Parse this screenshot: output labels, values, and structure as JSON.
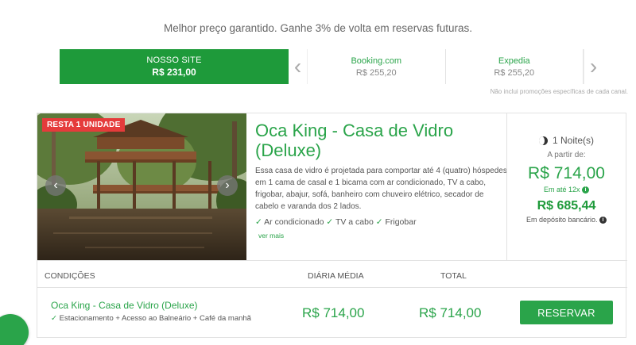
{
  "tagline": "Melhor preço garantido. Ganhe 3% de volta em reservas futuras.",
  "comparison": {
    "ours": {
      "label": "NOSSO SITE",
      "price": "R$ 231,00"
    },
    "others": [
      {
        "label": "Booking.com",
        "price": "R$ 255,20"
      },
      {
        "label": "Expedia",
        "price": "R$ 255,20"
      }
    ],
    "note": "Não inclui promoções específicas de cada canal.",
    "prev_icon": "chevron-left-icon",
    "next_icon": "chevron-right-icon"
  },
  "room": {
    "badge": "RESTA 1 UNIDADE",
    "title": "Oca King - Casa de Vidro (Deluxe)",
    "description": "Essa casa de vidro é projetada para comportar até 4 (quatro) hóspedes em 1 cama de casal e 1 bicama com ar condicionado, TV a cabo, frigobar, abajur, sofá, banheiro com chuveiro elétrico, secador de cabelo e varanda dos 2 lados.",
    "amenities": [
      "Ar condicionado",
      "TV a cabo",
      "Frigobar"
    ],
    "more_link": "ver mais"
  },
  "pricing": {
    "nights": "1 Noite(s)",
    "from_label": "A partir de:",
    "price": "R$ 714,00",
    "installments": "Em até 12x",
    "discount_price": "R$ 685,44",
    "discount_label": "Em depósito bancário."
  },
  "conditions": {
    "headers": {
      "conditions": "CONDIÇÕES",
      "daily": "DIÁRIA MÉDIA",
      "total": "TOTAL"
    },
    "rows": [
      {
        "name": "Oca King - Casa de Vidro (Deluxe)",
        "includes": "Estacionamento + Acesso ao Balneário + Café da manhã",
        "daily": "R$ 714,00",
        "total": "R$ 714,00",
        "button": "RESERVAR"
      }
    ]
  },
  "colors": {
    "brand_green": "#2aa44a",
    "active_green": "#1e9a3a",
    "badge_red": "#e53b3b"
  }
}
